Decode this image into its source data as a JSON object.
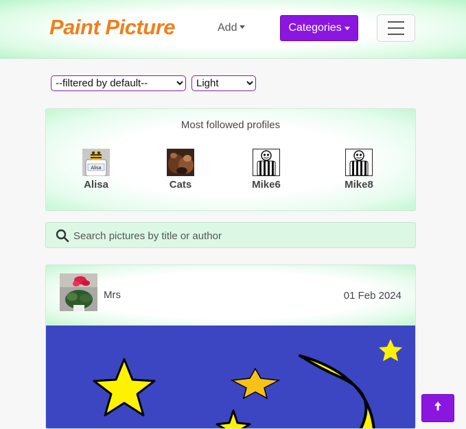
{
  "navbar": {
    "brand": "Paint Picture",
    "add_label": "Add",
    "categories_label": "Categories",
    "accent_color": "#8a16e0",
    "brand_color": "#ef7f1a"
  },
  "filters": {
    "filter_selected": "--filtered by default--",
    "theme_selected": "Light"
  },
  "profiles": {
    "title": "Most followed profiles",
    "items": [
      {
        "name": "Alisa",
        "icon": "bee-avatar"
      },
      {
        "name": "Cats",
        "icon": "cat-photo-avatar"
      },
      {
        "name": "Mike6",
        "icon": "stick-figure-avatar"
      },
      {
        "name": "Mike8",
        "icon": "stick-figure-avatar"
      }
    ]
  },
  "search": {
    "placeholder": "Search pictures by title or author"
  },
  "post": {
    "author": "Mrs",
    "date": "01 Feb 2024",
    "author_icon": "flower-photo-avatar",
    "image": "night-sky-painting"
  },
  "back_to_top": {
    "icon": "arrow-up-icon"
  }
}
